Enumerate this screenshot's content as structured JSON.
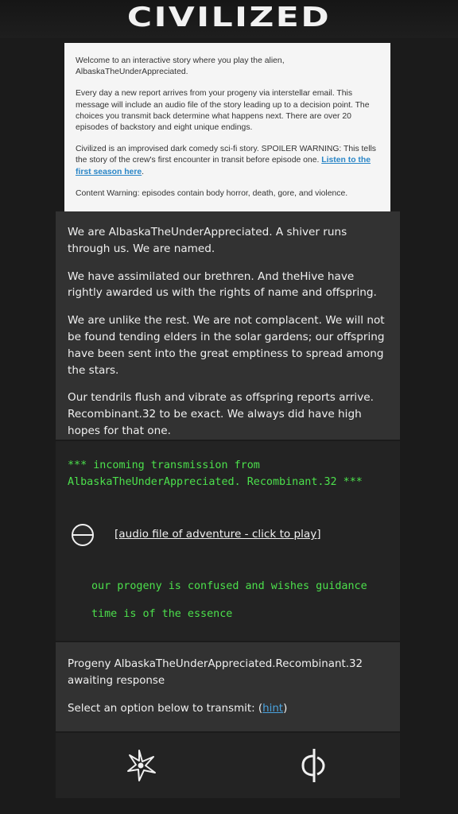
{
  "header": {
    "logo_text": "CIVILIZED"
  },
  "intro": {
    "p1": "Welcome to an interactive story where you play the alien, AlbaskaTheUnderAppreciated.",
    "p2": "Every day a new report arrives from your progeny via interstellar email. This message will include an audio file of the story leading up to a decision point. The choices you transmit back determine what happens next. There are over 20 episodes of backstory and eight unique endings.",
    "p3_text": "Civilized is an improvised dark comedy sci-fi story. SPOILER WARNING: This tells the story of the crew's first encounter in transit before episode one. ",
    "p3_link": "Listen to the first season here",
    "p3_end": ".",
    "p4": "Content Warning: episodes contain body horror, death, gore, and violence."
  },
  "story": {
    "paragraphs": [
      "We are AlbaskaTheUnderAppreciated. A shiver runs through us. We are named.",
      "We have assimilated our brethren. And theHive have rightly awarded us with the rights of name and offspring.",
      "We are unlike the rest. We are not complacent. We will not be found tending elders in the solar gardens; our offspring have been sent into the great emptiness to spread among the stars.",
      "Our tendrils flush and vibrate as offspring reports arrive. Recombinant.32 to be exact. We always did have high hopes for that one."
    ]
  },
  "transmission": {
    "header": "*** incoming transmission from AlbaskaTheUnderAppreciated. Recombinant.32 ***",
    "audio_icon": "play-disc-icon",
    "audio_label": "[audio file of adventure - click to play]",
    "line1": "our progeny is confused and wishes guidance",
    "line2": "time is of the essence"
  },
  "prompt": {
    "status": "Progeny AlbaskaTheUnderAppreciated.Recombinant.32 awaiting response",
    "select_text": "Select an option below to transmit:  (",
    "hint_link": "hint",
    "select_end": ")"
  },
  "choices": [
    {
      "icon": "starburst-icon"
    },
    {
      "icon": "phi-symbol-icon"
    }
  ],
  "colors": {
    "background": "#1b1b1b",
    "panel": "#323232",
    "panel_dark": "#232323",
    "green_text": "#4ce04c",
    "link": "#2a86c7"
  }
}
